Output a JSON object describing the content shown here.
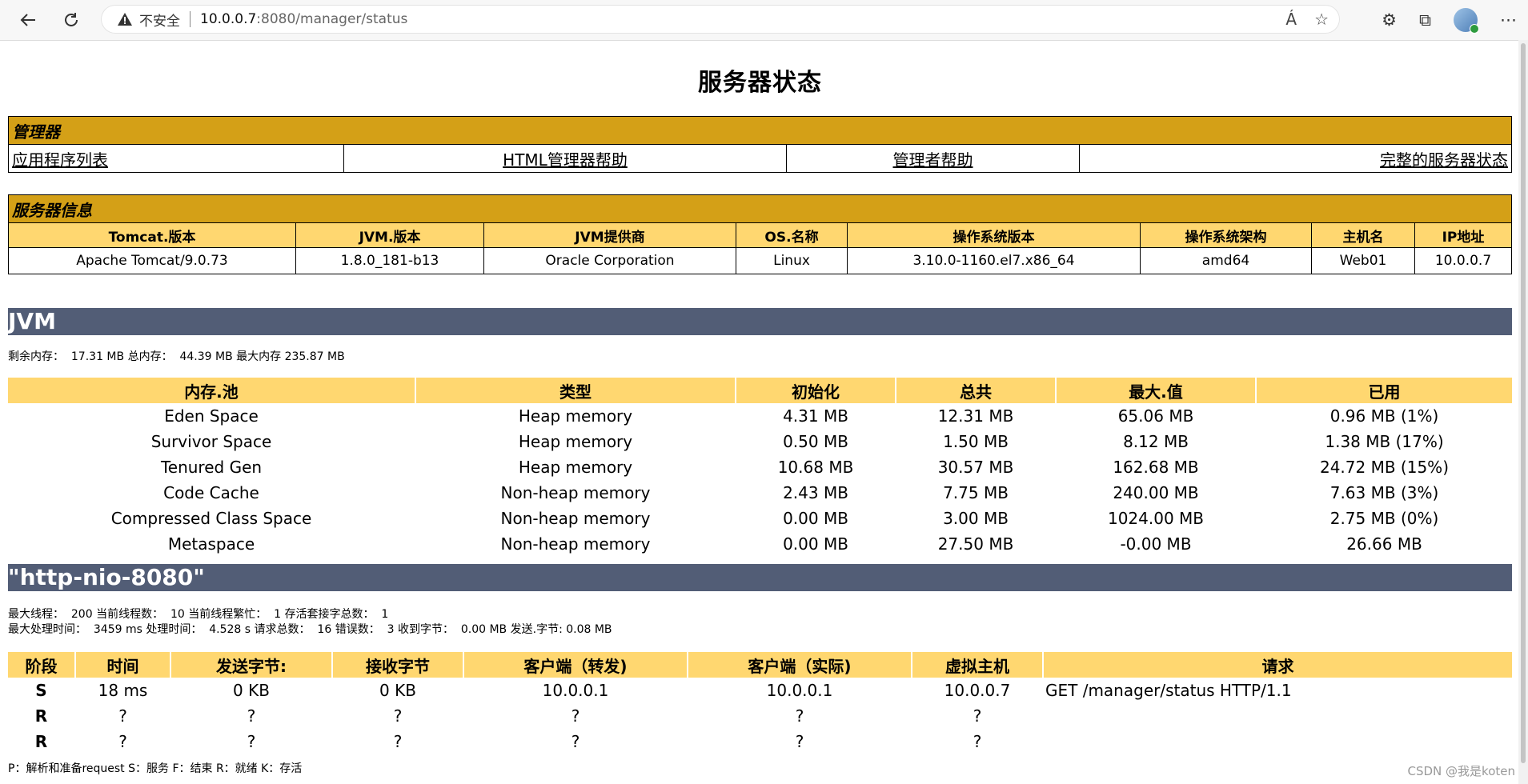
{
  "browser": {
    "insecure_label": "不安全",
    "url_host": "10.0.0.7",
    "url_rest": ":8080/manager/status"
  },
  "page": {
    "title": "服务器状态"
  },
  "manager": {
    "header": "管理器",
    "links": [
      "应用程序列表",
      "HTML管理器帮助",
      "管理者帮助",
      "完整的服务器状态"
    ]
  },
  "server_info": {
    "header": "服务器信息",
    "columns": [
      "Tomcat.版本",
      "JVM.版本",
      "JVM提供商",
      "OS.名称",
      "操作系统版本",
      "操作系统架构",
      "主机名",
      "IP地址"
    ],
    "values": [
      "Apache Tomcat/9.0.73",
      "1.8.0_181-b13",
      "Oracle Corporation",
      "Linux",
      "3.10.0-1160.el7.x86_64",
      "amd64",
      "Web01",
      "10.0.0.7"
    ]
  },
  "jvm": {
    "header": "JVM",
    "summary": "剩余内存：  17.31 MB 总内存：  44.39 MB 最大内存 235.87 MB",
    "columns": [
      "内存.池",
      "类型",
      "初始化",
      "总共",
      "最大.值",
      "已用"
    ],
    "rows": [
      [
        "Eden Space",
        "Heap memory",
        "4.31 MB",
        "12.31 MB",
        "65.06 MB",
        "0.96 MB (1%)"
      ],
      [
        "Survivor Space",
        "Heap memory",
        "0.50 MB",
        "1.50 MB",
        "8.12 MB",
        "1.38 MB (17%)"
      ],
      [
        "Tenured Gen",
        "Heap memory",
        "10.68 MB",
        "30.57 MB",
        "162.68 MB",
        "24.72 MB (15%)"
      ],
      [
        "Code Cache",
        "Non-heap memory",
        "2.43 MB",
        "7.75 MB",
        "240.00 MB",
        "7.63 MB (3%)"
      ],
      [
        "Compressed Class Space",
        "Non-heap memory",
        "0.00 MB",
        "3.00 MB",
        "1024.00 MB",
        "2.75 MB (0%)"
      ],
      [
        "Metaspace",
        "Non-heap memory",
        "0.00 MB",
        "27.50 MB",
        "-0.00 MB",
        "26.66 MB"
      ]
    ]
  },
  "connector": {
    "header": "\"http-nio-8080\"",
    "line1": "最大线程：  200 当前线程数：  10 当前线程繁忙：  1 存活套接字总数：  1",
    "line2": "最大处理时间：  3459 ms 处理时间：  4.528 s 请求总数：  16 错误数：  3 收到字节：  0.00 MB 发送.字节: 0.08 MB",
    "columns": [
      "阶段",
      "时间",
      "发送字节:",
      "接收字节",
      "客户端（转发)",
      "客户端（实际)",
      "虚拟主机",
      "请求"
    ],
    "rows": [
      [
        "S",
        "18 ms",
        "0 KB",
        "0 KB",
        "10.0.0.1",
        "10.0.0.1",
        "10.0.0.7",
        "GET /manager/status HTTP/1.1"
      ],
      [
        "R",
        "?",
        "?",
        "?",
        "?",
        "?",
        "?",
        ""
      ],
      [
        "R",
        "?",
        "?",
        "?",
        "?",
        "?",
        "?",
        ""
      ]
    ],
    "legend": "P：解析和准备request S：服务 F：结束 R：就绪 K：存活"
  },
  "watermark": "CSDN @我是koten"
}
